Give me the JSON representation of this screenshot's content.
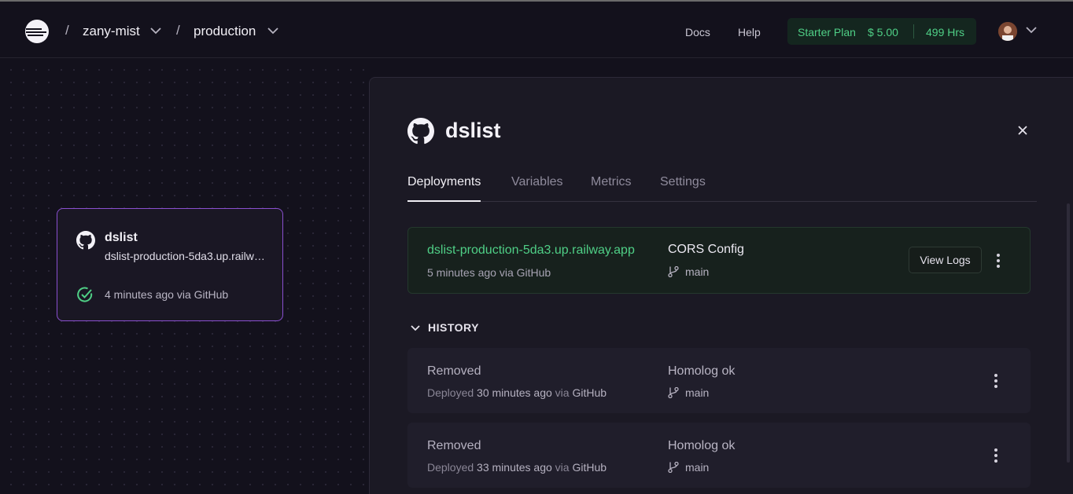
{
  "header": {
    "project": "zany-mist",
    "environment": "production",
    "links": [
      "Docs",
      "Help"
    ],
    "plan": {
      "name": "Starter Plan",
      "credit": "$ 5.00",
      "hours": "499 Hrs"
    }
  },
  "canvas": {
    "service_card": {
      "name": "dslist",
      "url": "dslist-production-5da3.up.railway.app",
      "status": "4 minutes ago via GitHub"
    }
  },
  "panel": {
    "title": "dslist",
    "tabs": [
      "Deployments",
      "Variables",
      "Metrics",
      "Settings"
    ],
    "active_tab": "Deployments",
    "active_deployment": {
      "url": "dslist-production-5da3.up.railway.app",
      "time": "5 minutes ago",
      "via": "via GitHub",
      "commit": "CORS Config",
      "branch": "main",
      "logs_button": "View Logs"
    },
    "history_label": "HISTORY",
    "history": [
      {
        "state": "Removed",
        "prefix": "Deployed",
        "time": "30 minutes ago",
        "via": "via",
        "source": "GitHub",
        "commit": "Homolog ok",
        "branch": "main"
      },
      {
        "state": "Removed",
        "prefix": "Deployed",
        "time": "33 minutes ago",
        "via": "via",
        "source": "GitHub",
        "commit": "Homolog ok",
        "branch": "main"
      }
    ]
  },
  "colors": {
    "accent_green": "#4fcf86",
    "card_border": "#8a4fd0",
    "background": "#13111c"
  }
}
